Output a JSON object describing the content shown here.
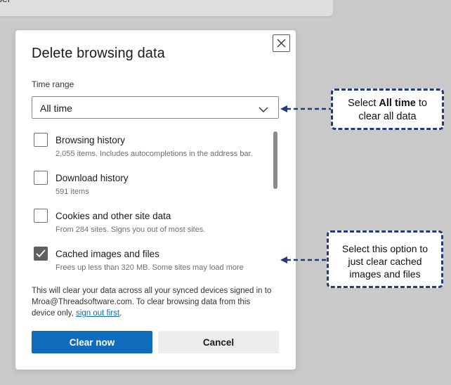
{
  "background": {
    "partial_text": "ser",
    "chevron": "chevron-right-icon"
  },
  "dialog": {
    "title": "Delete browsing data",
    "close_icon": "close-icon",
    "time_range": {
      "label": "Time range",
      "selected": "All time"
    },
    "options": [
      {
        "label": "Browsing history",
        "description": "2,055 items. Includes autocompletions in the address bar.",
        "checked": false
      },
      {
        "label": "Download history",
        "description": "591 items",
        "checked": false
      },
      {
        "label": "Cookies and other site data",
        "description": "From 284 sites. Signs you out of most sites.",
        "checked": false
      },
      {
        "label": "Cached images and files",
        "description": "Frees up less than 320 MB. Some sites may load more",
        "checked": true
      }
    ],
    "info": {
      "line1": "This will clear your data across all your synced devices signed in to",
      "line2": "Mroa@Threadsoftware.com. To clear browsing data from this",
      "line3_prefix": "device only, ",
      "link": "sign out first",
      "line3_suffix": "."
    },
    "buttons": {
      "primary": "Clear now",
      "secondary": "Cancel"
    }
  },
  "callouts": {
    "c1": {
      "line1_prefix": "Select ",
      "line1_bold": "All time",
      "line1_suffix": " to",
      "line2": "clear all data"
    },
    "c2": {
      "line1": "Select this option to",
      "line2": "just clear cached",
      "line3": "images and files"
    }
  },
  "colors": {
    "accent": "#0f6cbd",
    "callout_border": "#213b7e",
    "checkbox_checked": "#5f5f5f"
  }
}
